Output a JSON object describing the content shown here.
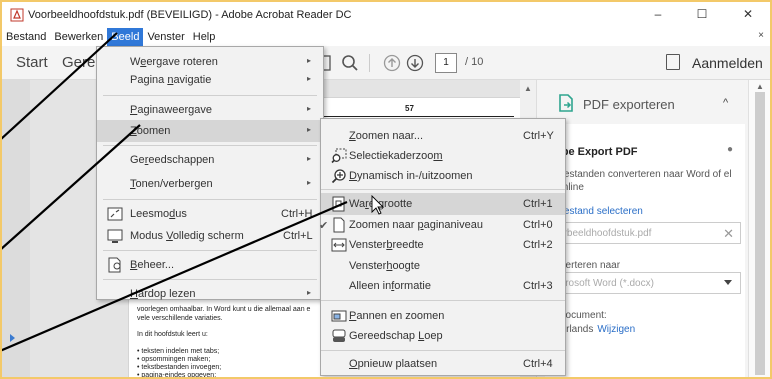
{
  "window": {
    "title": "Voorbeeldhoofdstuk.pdf (BEVEILIGD) - Adobe Acrobat Reader DC",
    "minimize": "–",
    "maximize": "☐",
    "close": "✕"
  },
  "menubar": {
    "items": [
      "Bestand",
      "Bewerken",
      "Beeld",
      "Venster",
      "Help"
    ],
    "active_index": 2,
    "close_doc": "×"
  },
  "toolbar": {
    "start": "Start",
    "gereed": "Geree",
    "page_current": "1",
    "page_total": "/ 10",
    "sign_in": "Aanmelden"
  },
  "document": {
    "page_number": "57",
    "lines_top": [
      "voorlegen omhaalbar. In Word kunt u die allemaal aan e",
      "vele verschillende variaties."
    ],
    "lead": "In dit hoofdstuk leert u:",
    "bullets": [
      "teksten indelen met tabs;",
      "opsommingen maken;",
      "tekstbestanden invoegen;",
      "pagina-eindes opgeven;"
    ]
  },
  "beeld_menu": {
    "items": [
      {
        "label": "Weergave roteren",
        "underline": "e",
        "submenu": true
      },
      {
        "label": "Pagina navigatie",
        "underline": "n",
        "submenu": true
      },
      {
        "label": "Paginaweergave",
        "underline": "P",
        "submenu": true
      },
      {
        "label": "Zoomen",
        "underline": "Z",
        "submenu": true,
        "highlighted": true
      },
      {
        "label": "Gereedschappen",
        "underline": "r",
        "submenu": true
      },
      {
        "label": "Tonen/verbergen",
        "underline": "T",
        "submenu": true
      },
      {
        "label": "Leesmodus",
        "shortcut": "Ctrl+H",
        "icon": "read-mode-icon"
      },
      {
        "label": "Modus Volledig scherm",
        "shortcut": "Ctrl+L",
        "icon": "fullscreen-icon"
      },
      {
        "label": "Beheer...",
        "icon": "manage-icon"
      },
      {
        "label": "Hardop lezen",
        "submenu": true
      }
    ]
  },
  "zoom_menu": {
    "items": [
      {
        "label": "Zoomen naar...",
        "shortcut": "Ctrl+Y"
      },
      {
        "label": "Selectiekaderzoom",
        "icon": "marquee-zoom-icon"
      },
      {
        "label": "Dynamisch in-/uitzoomen",
        "icon": "dynamic-zoom-icon"
      },
      {
        "label": "Ware grootte",
        "shortcut": "Ctrl+1",
        "icon": "actual-size-icon",
        "highlighted": true
      },
      {
        "label": "Zoomen naar paginaniveau",
        "shortcut": "Ctrl+0",
        "icon": "fit-page-icon",
        "checked": true
      },
      {
        "label": "Vensterbreedte",
        "shortcut": "Ctrl+2",
        "icon": "fit-width-icon"
      },
      {
        "label": "Vensterhoogte"
      },
      {
        "label": "Alleen informatie",
        "shortcut": "Ctrl+3"
      },
      {
        "label": "Pannen en zoomen",
        "icon": "pan-zoom-icon"
      },
      {
        "label": "Gereedschap Loep",
        "icon": "loupe-icon"
      },
      {
        "label": "Opnieuw plaatsen",
        "shortcut": "Ctrl+4"
      }
    ]
  },
  "right_panel": {
    "header": "PDF exporteren",
    "title": "obe Export PDF",
    "description": "-bestanden converteren naar Word of el Online",
    "select_link": "-bestand selecteren",
    "file_name": "orbeeldhoofdstuk.pdf",
    "convert_label": "nverteren naar",
    "format": "icrosoft Word (*.docx)",
    "doc_label": "l document:",
    "language": "derlands",
    "change": "Wijzigen"
  },
  "colors": {
    "menu_active": "#3078d8",
    "link": "#2a6ec7",
    "frame": "#f3c969",
    "export_icon": "#2fa58f"
  }
}
